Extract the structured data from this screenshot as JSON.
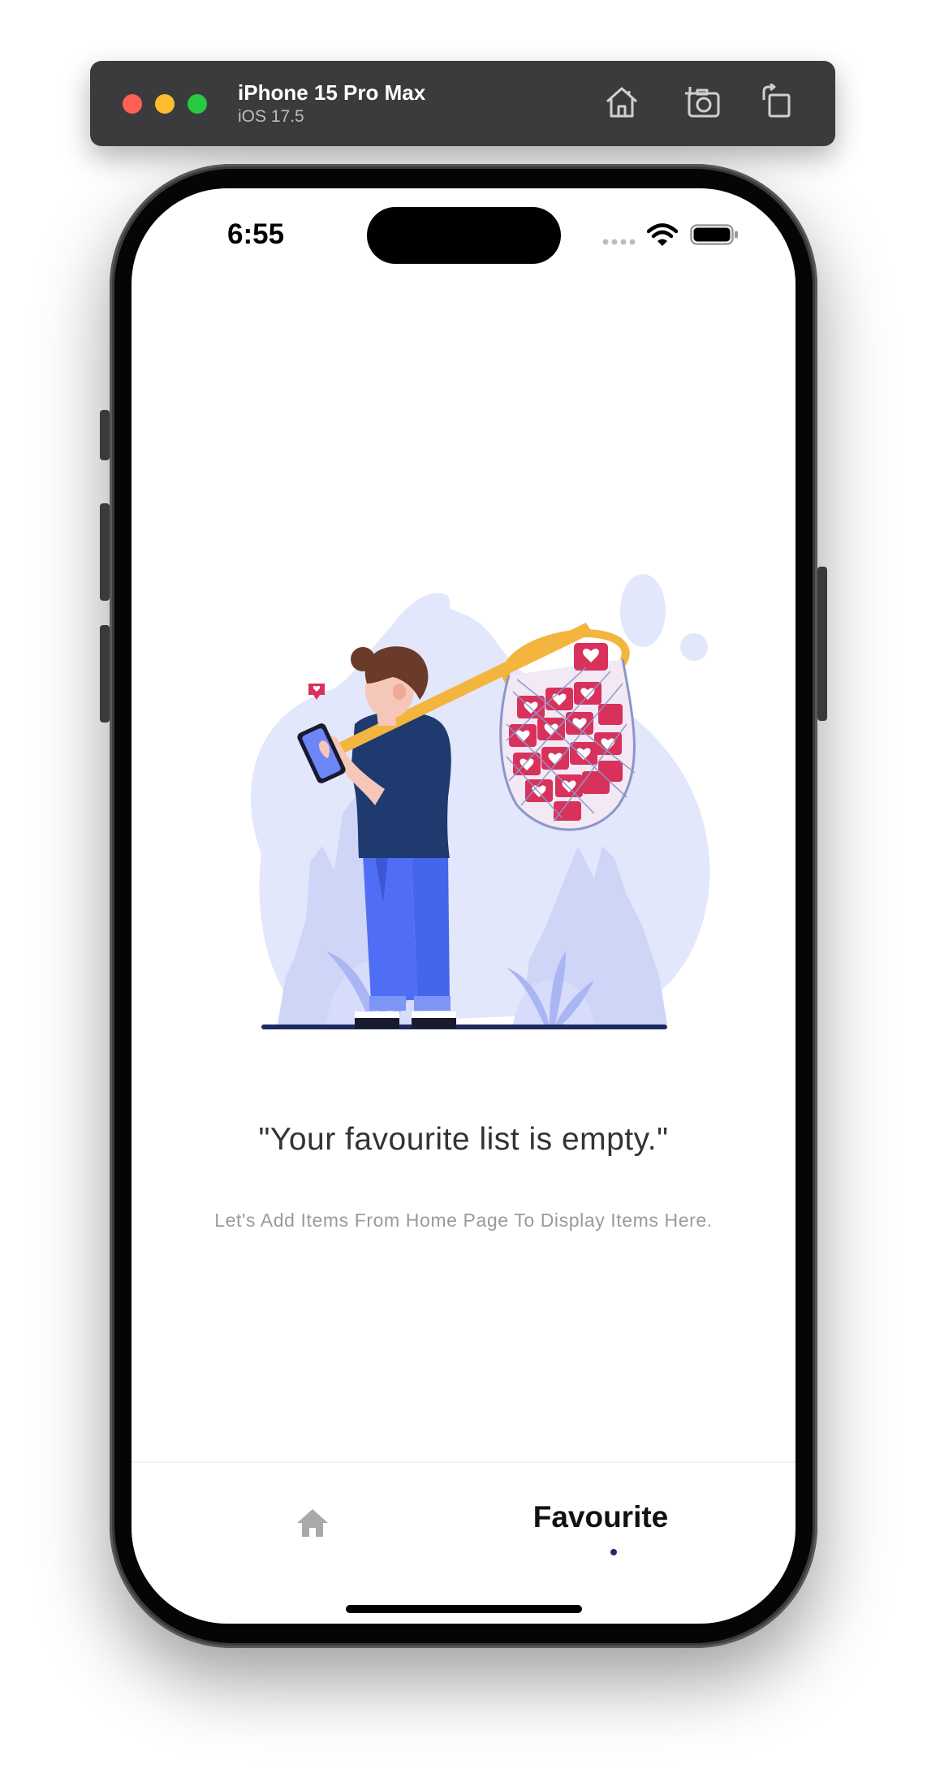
{
  "simulator": {
    "device_name": "iPhone 15 Pro Max",
    "os_version": "iOS 17.5",
    "toolbar_icons": [
      "home-icon",
      "screenshot-icon",
      "rotate-icon"
    ]
  },
  "status_bar": {
    "time": "6:55",
    "icons": [
      "cellular-icon",
      "wifi-icon",
      "battery-icon"
    ]
  },
  "empty_state": {
    "illustration": "person-with-heart-net-illustration",
    "title": "\"Your favourite list is empty.\"",
    "subtitle": "Let's Add Items From Home Page To Display Items Here."
  },
  "tab_bar": {
    "home_icon": "home-icon",
    "active_label": "Favourite",
    "active_color": "#1e2a6e"
  },
  "colors": {
    "illustration_blob": "#e3e7fb",
    "shirt": "#1e3a6e",
    "jeans": "#4f6ef5",
    "hearts": "#d8315b",
    "net_frame": "#f3b53d"
  }
}
